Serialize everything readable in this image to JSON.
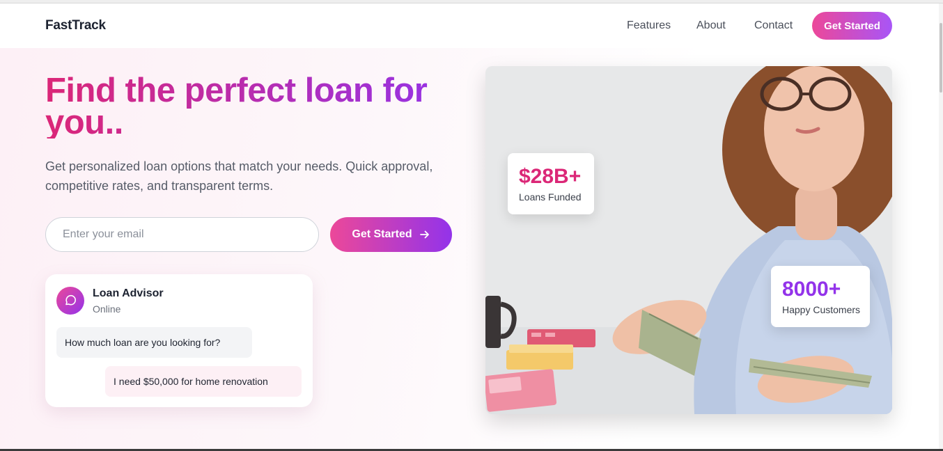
{
  "nav": {
    "brand": "FastTrack",
    "links": [
      "Features",
      "About",
      "Contact"
    ],
    "cta": "Get Started"
  },
  "hero": {
    "title": "Find the perfect loan for you..",
    "subtitle": "Get personalized loan options that match your needs. Quick approval, competitive rates, and transparent terms.",
    "email_placeholder": "Enter your email",
    "cta": "Get Started"
  },
  "chat": {
    "name": "Loan Advisor",
    "status": "Online",
    "question": "How much loan are you looking for?",
    "answer": "I need $50,000 for home renovation"
  },
  "stats": [
    {
      "value": "$28B+",
      "label": "Loans Funded"
    },
    {
      "value": "8000+",
      "label": "Happy Customers"
    }
  ],
  "colors": {
    "gradient_start": "#ec4899",
    "gradient_end": "#9333ea",
    "pink_text": "#db2777",
    "purple_text": "#9333ea"
  },
  "icons": {
    "chat_avatar": "message-circle-icon",
    "cta_arrow": "arrow-right-icon"
  }
}
